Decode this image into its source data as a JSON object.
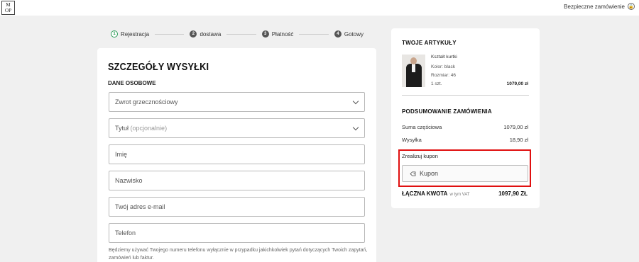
{
  "header": {
    "logo_line1": "M",
    "logo_line2": "OP",
    "secure_label": "Bezpieczne zamówienie",
    "secure_icon": "lock-icon"
  },
  "steps": [
    {
      "num": "1",
      "label": "Rejestracja"
    },
    {
      "num": "2",
      "label": "dostawa"
    },
    {
      "num": "3",
      "label": "Płatność"
    },
    {
      "num": "4",
      "label": "Gotowy"
    }
  ],
  "form": {
    "title": "SZCZEGÓŁY WYSYŁKI",
    "section": "DANE OSOBOWE",
    "salutation_placeholder": "Zwrot grzecznościowy",
    "title_placeholder": "Tytuł",
    "title_optional": "(opcjonalnie)",
    "first_name_placeholder": "Imię",
    "last_name_placeholder": "Nazwisko",
    "email_placeholder": "Twój adres e-mail",
    "phone_placeholder": "Telefon",
    "phone_note": "Będziemy używać Twojego numeru telefonu wyłącznie w przypadku jakichkolwiek pytań dotyczących Twoich zapytań, zamówień lub faktur."
  },
  "summary": {
    "items_heading": "TWOJE ARTYKUŁY",
    "item": {
      "name": "Kształt kurtki",
      "color": "Kolor: black",
      "size": "Rozmiar: 46",
      "qty": "1 szt.",
      "price": "1079,00 zł"
    },
    "order_heading": "PODSUMOWANIE ZAMÓWIENIA",
    "subtotal_label": "Suma częściowa",
    "subtotal_value": "1079,00 zł",
    "shipping_label": "Wysyłka",
    "shipping_value": "18,90 zł",
    "coupon_label": "Zrealizuj kupon",
    "coupon_button": "Kupon",
    "total_label": "ŁĄCZNA KWOTA",
    "total_vat": "w tym VAT",
    "total_value": "1097,90 ZŁ"
  },
  "colors": {
    "accent_step": "#2e9c5a",
    "highlight": "#e01010"
  }
}
